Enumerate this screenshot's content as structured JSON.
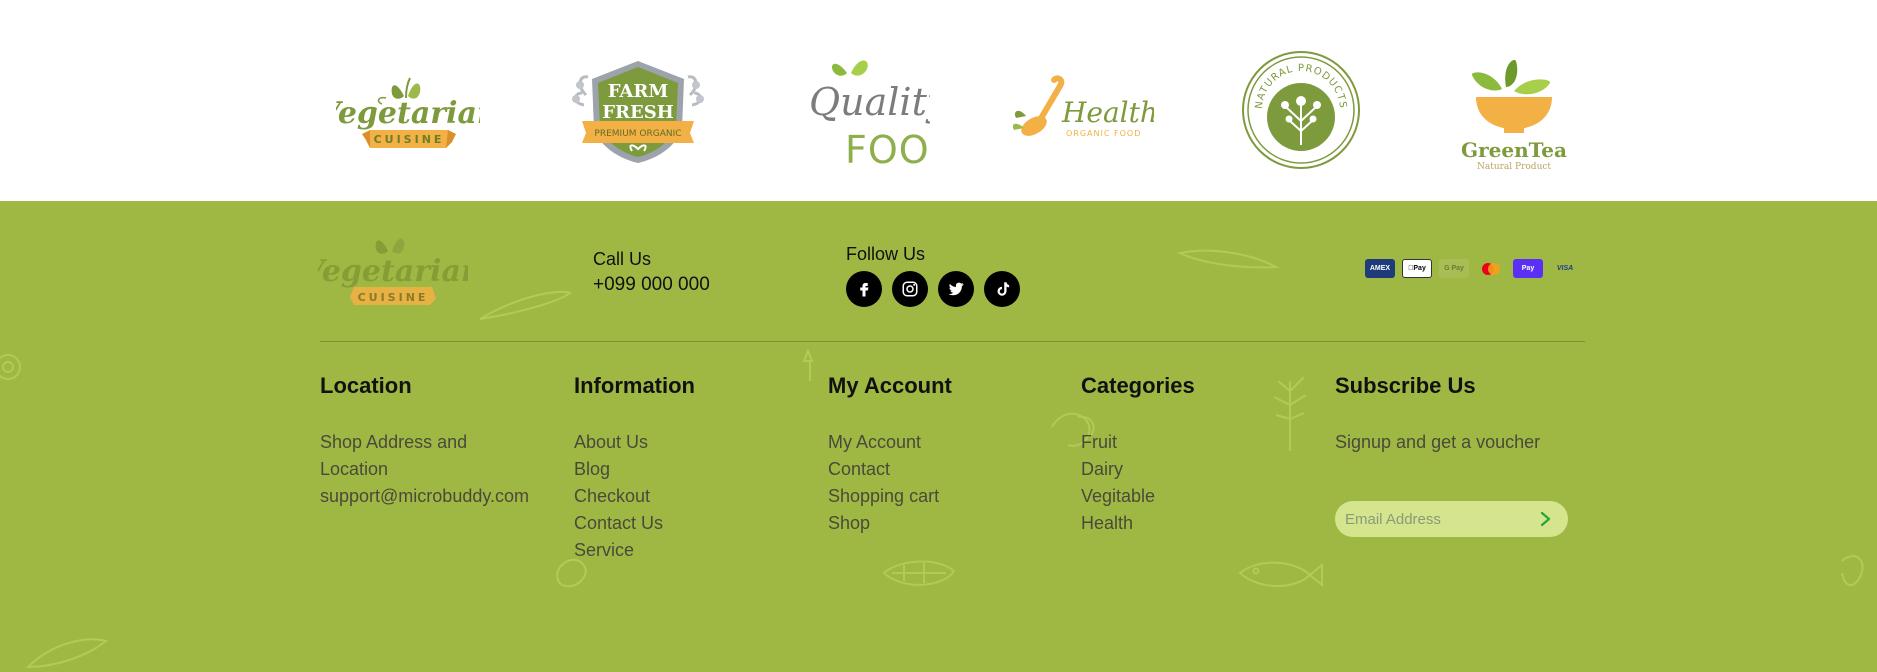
{
  "brands": [
    {
      "name": "vegetarian-cuisine-logo",
      "title": "Vegetarian",
      "sub": "CUISINE"
    },
    {
      "name": "farm-fresh-logo",
      "title_1": "FARM",
      "title_2": "FRESH",
      "sub": "PREMIUM ORGANIC"
    },
    {
      "name": "quality-food-logo",
      "title_1": "Quality",
      "title_2": "FOOD"
    },
    {
      "name": "health-logo",
      "title": "Health",
      "sub": "ORGANIC FOOD"
    },
    {
      "name": "natural-products-logo",
      "title": "NATURAL PRODUCTS"
    },
    {
      "name": "greentea-logo",
      "title": "GreenTea",
      "sub": "Natural Product"
    }
  ],
  "footer": {
    "logo": {
      "title": "Vegetarian",
      "sub": "CUISINE"
    },
    "call": {
      "label": "Call Us",
      "number": "+099 000 000"
    },
    "follow": {
      "label": "Follow Us",
      "socials": [
        {
          "icon": "facebook-icon"
        },
        {
          "icon": "instagram-icon"
        },
        {
          "icon": "twitter-icon"
        },
        {
          "icon": "tiktok-icon"
        }
      ]
    },
    "payments": [
      {
        "icon": "amex-card-icon",
        "label": "AMEX"
      },
      {
        "icon": "apple-pay-icon",
        "label": "Pay"
      },
      {
        "icon": "google-pay-icon",
        "label": "G Pay"
      },
      {
        "icon": "mastercard-icon",
        "label": ""
      },
      {
        "icon": "shop-pay-icon",
        "label": "Pay"
      },
      {
        "icon": "visa-icon",
        "label": "VISA"
      }
    ],
    "location": {
      "heading": "Location",
      "lines": [
        "Shop Address and",
        "Location",
        "support@microbuddy.com"
      ]
    },
    "information": {
      "heading": "Information",
      "links": [
        "About Us",
        "Blog",
        "Checkout",
        "Contact Us",
        "Service"
      ]
    },
    "account": {
      "heading": "My Account",
      "links": [
        "My Account",
        "Contact",
        "Shopping cart",
        "Shop"
      ]
    },
    "categories": {
      "heading": "Categories",
      "links": [
        "Fruit",
        "Dairy",
        "Vegitable",
        "Health"
      ]
    },
    "subscribe": {
      "heading": "Subscribe Us",
      "text": "Signup and get a voucher",
      "placeholder": "Email Address"
    }
  },
  "colors": {
    "footer_bg": "#9fb844",
    "brand_green": "#7d9a3c",
    "brand_orange": "#f3b044",
    "input_bg": "#d4e58e",
    "arrow_green": "#27a43a"
  }
}
